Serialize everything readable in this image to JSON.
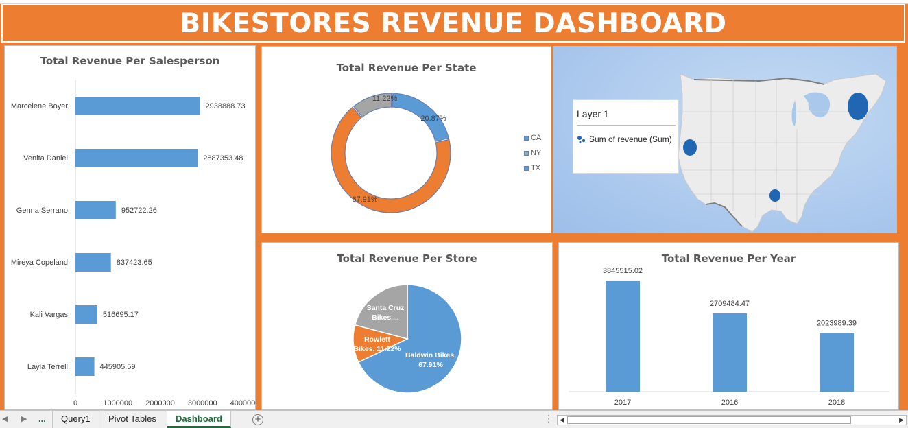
{
  "title": "BIKESTORES REVENUE DASHBOARD",
  "colors": {
    "orange": "#ed7d31",
    "blue": "#5b9bd5",
    "gray": "#a5a5a5",
    "map_blue": "#2166b3"
  },
  "chart_data": [
    {
      "type": "bar",
      "orientation": "horizontal",
      "title": "Total Revenue Per Salesperson",
      "categories": [
        "Marcelene Boyer",
        "Venita Daniel",
        "Genna Serrano",
        "Mireya Copeland",
        "Kali Vargas",
        "Layla Terrell"
      ],
      "values": [
        2938888.73,
        2887353.48,
        952722.26,
        837423.65,
        516695.17,
        445905.59
      ],
      "value_labels": [
        "2938888.73",
        "2887353.48",
        "952722.26",
        "837423.65",
        "516695.17",
        "445905.59"
      ],
      "xlim": [
        0,
        4000000
      ],
      "xticks": [
        "0",
        "1000000",
        "2000000",
        "3000000",
        "4000000"
      ],
      "grid": false
    },
    {
      "type": "pie",
      "variant": "donut",
      "title": "Total Revenue Per State",
      "categories": [
        "CA",
        "NY",
        "TX"
      ],
      "values": [
        20.87,
        67.91,
        11.22
      ],
      "value_labels": [
        "20.87%",
        "67.91%",
        "11.22%"
      ],
      "legend": [
        "CA",
        "NY",
        "TX"
      ],
      "legend_position": "right"
    },
    {
      "type": "pie",
      "title": "Total Revenue Per Store",
      "categories": [
        "Baldwin Bikes",
        "Rowlett Bikes",
        "Santa Cruz Bikes"
      ],
      "values": [
        67.91,
        11.22,
        20.87
      ],
      "label_lines": [
        [
          "Baldwin Bikes,",
          "67.91%"
        ],
        [
          "Rowlett",
          "Bikes, 11.22%"
        ],
        [
          "Santa Cruz",
          "Bikes,..."
        ]
      ]
    },
    {
      "type": "bar",
      "title": "Total Revenue Per Year",
      "categories": [
        "2017",
        "2016",
        "2018"
      ],
      "values": [
        3845515.02,
        2709484.47,
        2023989.39
      ],
      "value_labels": [
        "3845515.02",
        "2709484.47",
        "2023989.39"
      ],
      "ylim": [
        0,
        4200000
      ],
      "grid": false
    }
  ],
  "map": {
    "legend_title": "Layer 1",
    "legend_item": "Sum of revenue (Sum)",
    "bubbles": [
      {
        "state": "NY",
        "value": 67.91
      },
      {
        "state": "CA",
        "value": 20.87
      },
      {
        "state": "TX",
        "value": 11.22
      }
    ]
  },
  "tabs": {
    "more": "...",
    "items": [
      "Query1",
      "Pivot Tables",
      "Dashboard"
    ],
    "active": "Dashboard"
  }
}
